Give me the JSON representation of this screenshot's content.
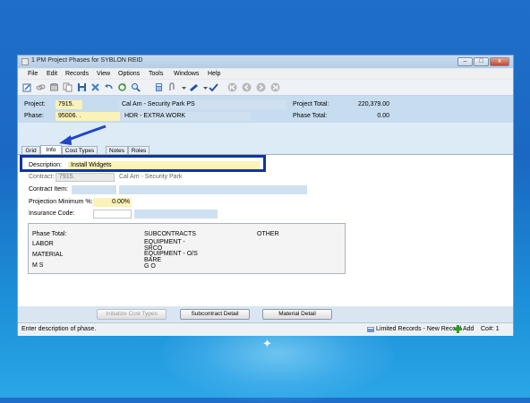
{
  "window": {
    "title": "1 PM Project Phases for SYBLON REID",
    "controls": {
      "minimize": "–",
      "maximize": "□",
      "close": "x"
    }
  },
  "menu": [
    "File",
    "Edit",
    "Records",
    "View",
    "Options",
    "Tools",
    "Windows",
    "Help"
  ],
  "toolbar_icons": [
    "edit-icon",
    "link-icon",
    "database-icon",
    "copy-icon",
    "save-icon",
    "delete-icon",
    "undo-icon",
    "refresh-icon",
    "search-icon",
    "calculator-icon",
    "attachment-icon",
    "dropdown-icon",
    "pen-icon",
    "spellcheck-icon",
    "first-record-icon",
    "previous-record-icon",
    "next-record-icon",
    "last-record-icon"
  ],
  "header": {
    "project_label": "Project:",
    "project_value": "7915.",
    "project_name": "Cal Am - Security Park PS",
    "phase_label": "Phase:",
    "phase_value": "95006.  .",
    "phase_name": "HDR - EXTRA WORK",
    "project_total_label": "Project Total:",
    "project_total_value": "220,379.00",
    "phase_total_label": "Phase Total:",
    "phase_total_value": "0.00"
  },
  "tabs": [
    {
      "label": "Grid",
      "active": false
    },
    {
      "label": "Info",
      "active": true
    },
    {
      "label": "Cost Types",
      "active": false
    },
    {
      "label": "Notes",
      "active": false
    },
    {
      "label": "Roles",
      "active": false
    }
  ],
  "form": {
    "description_label": "Description:",
    "description_value": "Install Widgets",
    "contract_label": "Contract:",
    "contract_value": "7915.",
    "contract_name": "Cal Am - Security Park",
    "contract_item_label": "Contract Item:",
    "projection_label": "Projection Minimum %:",
    "projection_value": "0.00%",
    "insurance_label": "Insurance Code:"
  },
  "summary": {
    "phase_total_label": "Phase Total:",
    "labor": "LABOR",
    "material": "MATERIAL",
    "ms": "M  S",
    "subcontracts": "SUBCONTRACTS",
    "equipment_srco_1": "EQUIPMENT -",
    "equipment_srco_2": "SRCO",
    "equipment_os_1": "EQUIPMENT - O/S",
    "equipment_os_2": "BARE",
    "go": "G  O",
    "other": "OTHER"
  },
  "buttons": {
    "initialize": "Initialize Cost Types",
    "subcontract": "Subcontract Detail",
    "material": "Material Detail"
  },
  "status": {
    "message": "Enter description of phase.",
    "records": "Limited Records - New Record",
    "add": "Add",
    "company": "Co#: 1"
  },
  "colors": {
    "highlight_box": "#1233a6",
    "arrow": "#1f45c7",
    "required_field": "#fbf2b8"
  }
}
